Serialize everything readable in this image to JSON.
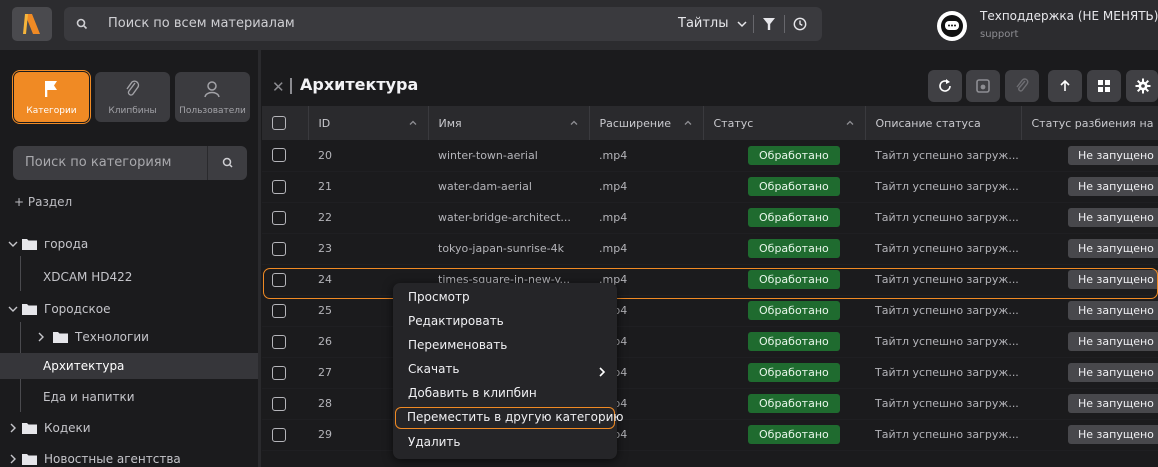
{
  "topbar": {
    "search_placeholder": "Поиск по всем материалам",
    "filter_dropdown": "Тайтлы",
    "support_name": "Техподдержка (НЕ МЕНЯТЬ)",
    "support_sub": "support"
  },
  "sidebar": {
    "tabs": [
      "Категории",
      "Клипбины",
      "Пользователи"
    ],
    "active_tab": "Категории",
    "search_placeholder": "Поиск по категориям",
    "add_section": "+ Раздел",
    "tree": [
      {
        "label": "города",
        "expanded": true,
        "folder": true
      },
      {
        "label": "XDCAM HD422",
        "child": true
      },
      {
        "label": "Городское",
        "expanded": true,
        "folder": true
      },
      {
        "label": "Технологии",
        "folder": true,
        "child": true
      },
      {
        "label": "Архитектура",
        "child": true,
        "selected": true
      },
      {
        "label": "Еда и напитки",
        "child": true
      },
      {
        "label": "Кодеки",
        "folder": true
      },
      {
        "label": "Новостные агентства",
        "folder": true
      }
    ]
  },
  "main": {
    "title": "Архитектура",
    "columns": [
      "ID",
      "Имя",
      "Расширение",
      "Статус",
      "Описание статуса",
      "Статус разбиения на"
    ],
    "rows": [
      {
        "id": "20",
        "name": "winter-town-aerial",
        "ext": ".mp4",
        "status": "Обработано",
        "desc": "Тайтл успешно загруж...",
        "split": "Не запущено"
      },
      {
        "id": "21",
        "name": "water-dam-aerial",
        "ext": ".mp4",
        "status": "Обработано",
        "desc": "Тайтл успешно загруж...",
        "split": "Не запущено"
      },
      {
        "id": "22",
        "name": "water-bridge-architect...",
        "ext": ".mp4",
        "status": "Обработано",
        "desc": "Тайтл успешно загруж...",
        "split": "Не запущено"
      },
      {
        "id": "23",
        "name": "tokyo-japan-sunrise-4k",
        "ext": ".mp4",
        "status": "Обработано",
        "desc": "Тайтл успешно загруж...",
        "split": "Не запущено"
      },
      {
        "id": "24",
        "name": "times-square-in-new-y...",
        "ext": ".mp4",
        "status": "Обработано",
        "desc": "Тайтл успешно загруж...",
        "split": "Не запущено"
      },
      {
        "id": "25",
        "name": "",
        "ext": ".mp4",
        "status": "Обработано",
        "desc": "Тайтл успешно загруж...",
        "split": "Не запущено"
      },
      {
        "id": "26",
        "name": "",
        "ext": ".mp4",
        "status": "Обработано",
        "desc": "Тайтл успешно загруж...",
        "split": "Не запущено"
      },
      {
        "id": "27",
        "name": "",
        "ext": ".mp4",
        "status": "Обработано",
        "desc": "Тайтл успешно загруж...",
        "split": "Не запущено"
      },
      {
        "id": "28",
        "name": "",
        "ext": ".mp4",
        "status": "Обработано",
        "desc": "Тайтл успешно загруж...",
        "split": "Не запущено"
      },
      {
        "id": "29",
        "name": "",
        "ext": ".mp4",
        "status": "Обработано",
        "desc": "Тайтл успешно загруж...",
        "split": "Не запущено"
      }
    ]
  },
  "context_menu": {
    "items": [
      "Просмотр",
      "Редактировать",
      "Переименовать",
      "Скачать",
      "Добавить в клипбин",
      "Переместить в другую категорию",
      "Удалить"
    ],
    "highlighted": "Переместить в другую категорию"
  },
  "colors": {
    "accent": "#f08a24",
    "status_ok": "#1f6b2f",
    "status_not_started": "#48484c"
  }
}
